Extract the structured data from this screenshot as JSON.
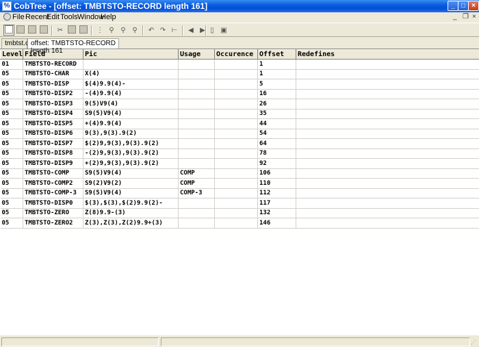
{
  "window": {
    "title": "CobTree - [offset: TMBTSTO-RECORD length 161]"
  },
  "menu": [
    "File",
    "Recent",
    "Edit",
    "Tools",
    "Window",
    "Help"
  ],
  "tabs": [
    "tmbtst.cbl",
    "offset: TMBTSTO-RECORD length 161"
  ],
  "columns": [
    "Level",
    "Field",
    "Pic",
    "Usage",
    "Occurence",
    "Offset",
    "Redefines"
  ],
  "rows": [
    {
      "level": "01",
      "field": "TMBTSTO-RECORD",
      "pic": "",
      "usage": "",
      "occurence": "",
      "offset": "1",
      "redefines": ""
    },
    {
      "level": "05",
      "field": "TMBTSTO-CHAR",
      "pic": "X(4)",
      "usage": "",
      "occurence": "",
      "offset": "1",
      "redefines": ""
    },
    {
      "level": "05",
      "field": "TMBTSTO-DISP",
      "pic": "$(4)9.9(4)-",
      "usage": "",
      "occurence": "",
      "offset": "5",
      "redefines": ""
    },
    {
      "level": "05",
      "field": "TMBTSTO-DISP2",
      "pic": "-(4)9.9(4)",
      "usage": "",
      "occurence": "",
      "offset": "16",
      "redefines": ""
    },
    {
      "level": "05",
      "field": "TMBTSTO-DISP3",
      "pic": "9(5)V9(4)",
      "usage": "",
      "occurence": "",
      "offset": "26",
      "redefines": ""
    },
    {
      "level": "05",
      "field": "TMBTSTO-DISP4",
      "pic": "S9(5)V9(4)",
      "usage": "",
      "occurence": "",
      "offset": "35",
      "redefines": ""
    },
    {
      "level": "05",
      "field": "TMBTSTO-DISP5",
      "pic": "+(4)9.9(4)",
      "usage": "",
      "occurence": "",
      "offset": "44",
      "redefines": ""
    },
    {
      "level": "05",
      "field": "TMBTSTO-DISP6",
      "pic": "9(3),9(3).9(2)",
      "usage": "",
      "occurence": "",
      "offset": "54",
      "redefines": ""
    },
    {
      "level": "05",
      "field": "TMBTSTO-DISP7",
      "pic": "$(2)9,9(3),9(3).9(2)",
      "usage": "",
      "occurence": "",
      "offset": "64",
      "redefines": ""
    },
    {
      "level": "05",
      "field": "TMBTSTO-DISP8",
      "pic": "-(2)9,9(3),9(3).9(2)",
      "usage": "",
      "occurence": "",
      "offset": "78",
      "redefines": ""
    },
    {
      "level": "05",
      "field": "TMBTSTO-DISP9",
      "pic": "+(2)9,9(3),9(3).9(2)",
      "usage": "",
      "occurence": "",
      "offset": "92",
      "redefines": ""
    },
    {
      "level": "05",
      "field": "TMBTSTO-COMP",
      "pic": "S9(5)V9(4)",
      "usage": "COMP",
      "occurence": "",
      "offset": "106",
      "redefines": ""
    },
    {
      "level": "05",
      "field": "TMBTSTO-COMP2",
      "pic": "S9(2)V9(2)",
      "usage": "COMP",
      "occurence": "",
      "offset": "110",
      "redefines": ""
    },
    {
      "level": "05",
      "field": "TMBTSTO-COMP-3",
      "pic": "S9(5)V9(4)",
      "usage": "COMP-3",
      "occurence": "",
      "offset": "112",
      "redefines": ""
    },
    {
      "level": "05",
      "field": "TMBTSTO-DISP0",
      "pic": "$(3),$(3),$(2)9.9(2)-",
      "usage": "",
      "occurence": "",
      "offset": "117",
      "redefines": ""
    },
    {
      "level": "05",
      "field": "TMBTSTO-ZERO",
      "pic": "Z(8)9.9-(3)",
      "usage": "",
      "occurence": "",
      "offset": "132",
      "redefines": ""
    },
    {
      "level": "05",
      "field": "TMBTSTO-ZERO2",
      "pic": "Z(3),Z(3),Z(2)9.9+(3)",
      "usage": "",
      "occurence": "",
      "offset": "146",
      "redefines": ""
    }
  ],
  "toolbar_icons": [
    "new-icon",
    "open-icon",
    "save-icon",
    "print-icon",
    "cut-icon",
    "copy-icon",
    "paste-icon",
    "tree-icon",
    "find-icon",
    "find-next-icon",
    "find-prev-icon",
    "back-icon",
    "forward-icon",
    "collapse-icon",
    "left-icon",
    "right-icon",
    "delete-icon",
    "properties-icon"
  ],
  "colors": {
    "title_bar": "#0a5ce0",
    "face": "#ece9d8",
    "close_button": "#c83a14"
  }
}
